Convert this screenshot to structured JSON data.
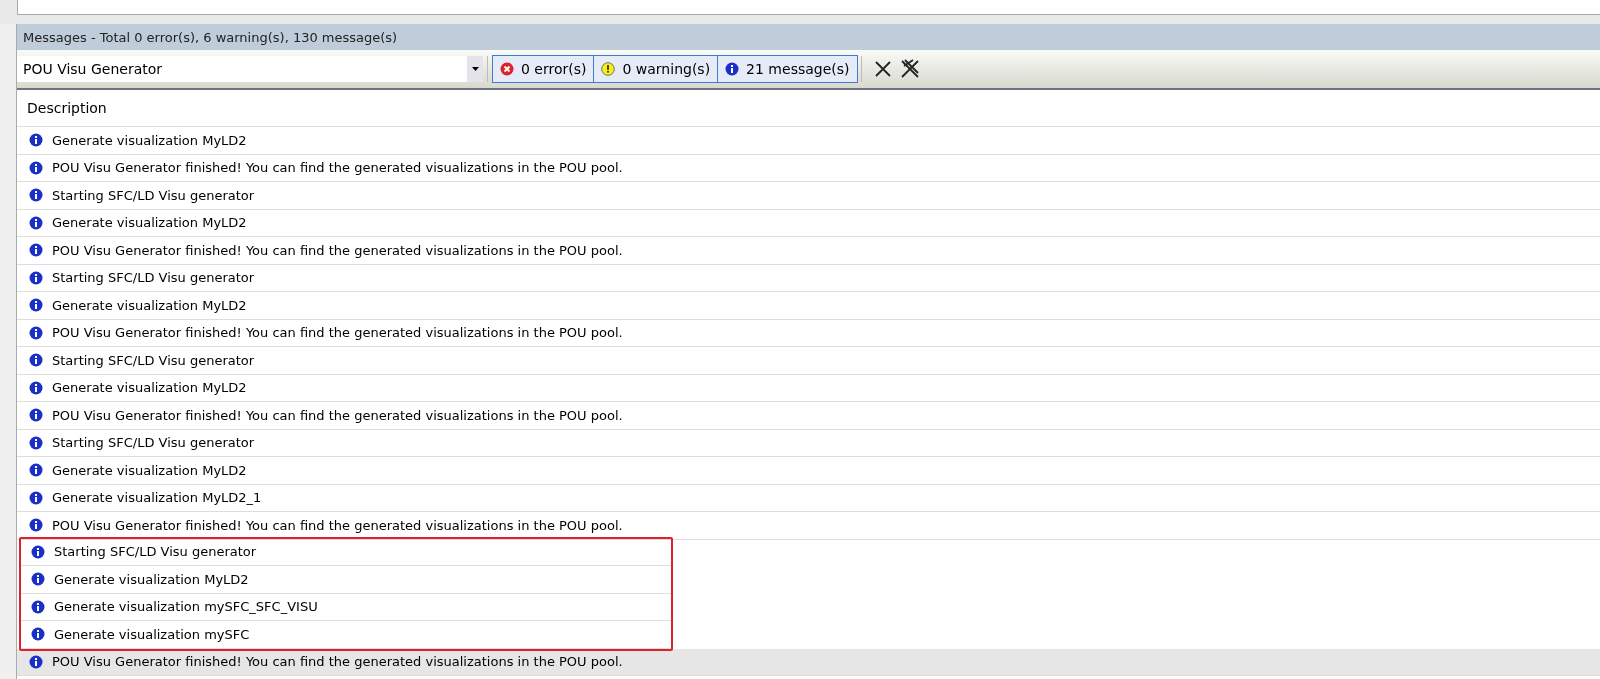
{
  "panel_title": "Messages - Total 0 error(s), 6 warning(s), 130 message(s)",
  "filter": {
    "value": "POU Visu Generator"
  },
  "toggles": [
    {
      "kind": "error",
      "label": "0 error(s)",
      "selected": true
    },
    {
      "kind": "warning",
      "label": "0 warning(s)",
      "selected": true
    },
    {
      "kind": "info",
      "label": "21 message(s)",
      "selected": true
    }
  ],
  "table": {
    "columns": [
      "Description"
    ],
    "rows": [
      {
        "text": "Generate visualization MyLD2",
        "selected": false,
        "highlighted": false
      },
      {
        "text": "POU Visu Generator finished! You can find the generated visualizations in the POU pool.",
        "selected": false,
        "highlighted": false
      },
      {
        "text": "Starting SFC/LD Visu generator",
        "selected": false,
        "highlighted": false
      },
      {
        "text": "Generate visualization MyLD2",
        "selected": false,
        "highlighted": false
      },
      {
        "text": "POU Visu Generator finished! You can find the generated visualizations in the POU pool.",
        "selected": false,
        "highlighted": false
      },
      {
        "text": "Starting SFC/LD Visu generator",
        "selected": false,
        "highlighted": false
      },
      {
        "text": "Generate visualization MyLD2",
        "selected": false,
        "highlighted": false
      },
      {
        "text": "POU Visu Generator finished! You can find the generated visualizations in the POU pool.",
        "selected": false,
        "highlighted": false
      },
      {
        "text": "Starting SFC/LD Visu generator",
        "selected": false,
        "highlighted": false
      },
      {
        "text": "Generate visualization MyLD2",
        "selected": false,
        "highlighted": false
      },
      {
        "text": "POU Visu Generator finished! You can find the generated visualizations in the POU pool.",
        "selected": false,
        "highlighted": false
      },
      {
        "text": "Starting SFC/LD Visu generator",
        "selected": false,
        "highlighted": false
      },
      {
        "text": "Generate visualization MyLD2",
        "selected": false,
        "highlighted": false
      },
      {
        "text": "Generate visualization MyLD2_1",
        "selected": false,
        "highlighted": false
      },
      {
        "text": "POU Visu Generator finished! You can find the generated visualizations in the POU pool.",
        "selected": false,
        "highlighted": false
      },
      {
        "text": "Starting SFC/LD Visu generator",
        "selected": false,
        "highlighted": true
      },
      {
        "text": "Generate visualization MyLD2",
        "selected": false,
        "highlighted": true
      },
      {
        "text": "Generate visualization mySFC_SFC_VISU",
        "selected": false,
        "highlighted": true
      },
      {
        "text": "Generate visualization mySFC",
        "selected": false,
        "highlighted": true
      },
      {
        "text": "POU Visu Generator finished! You can find the generated visualizations in the POU pool.",
        "selected": true,
        "highlighted": false
      }
    ]
  }
}
